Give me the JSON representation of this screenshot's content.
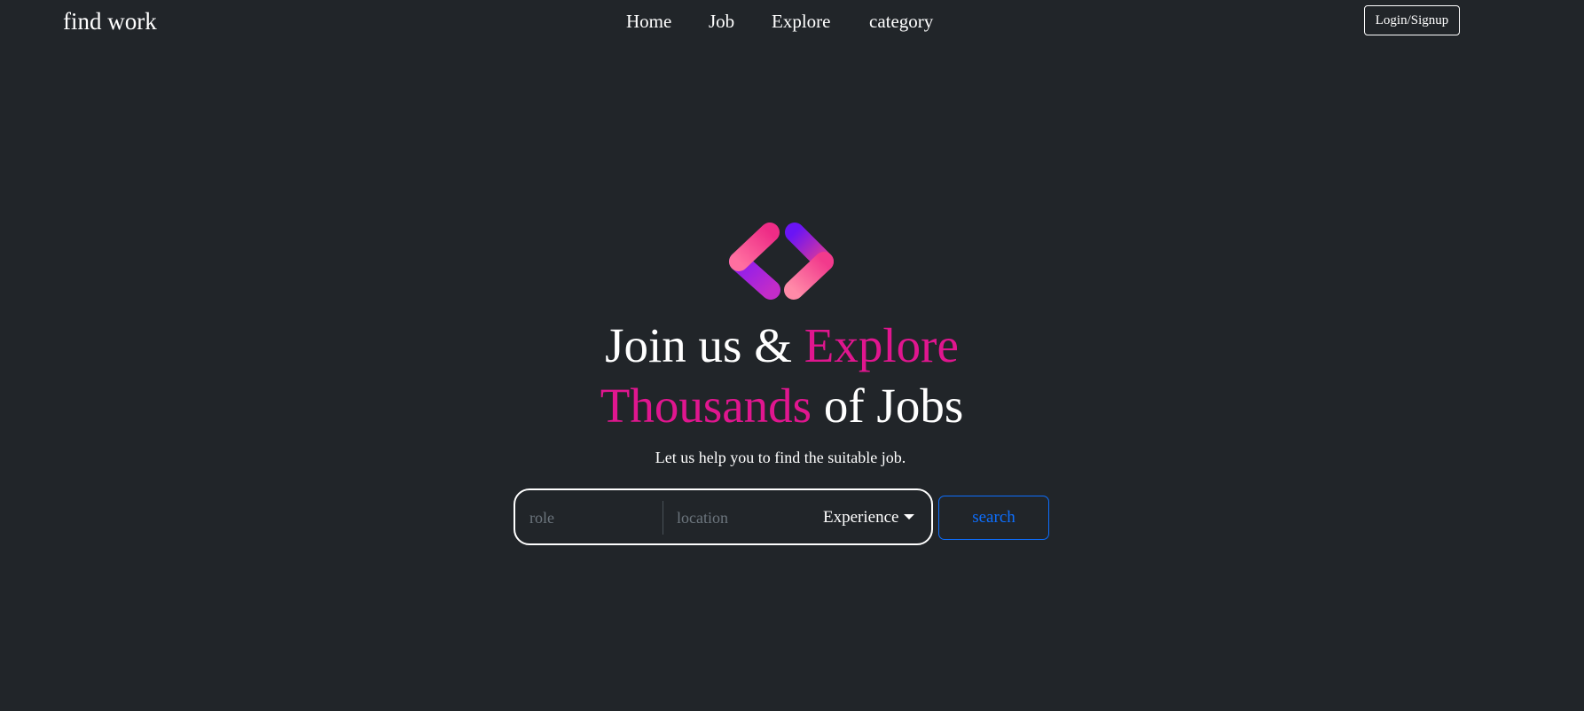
{
  "header": {
    "brand": "find work",
    "nav": [
      "Home",
      "Job",
      "Explore",
      "category"
    ],
    "login_label": "Login/Signup"
  },
  "hero": {
    "logo_icon": "code-brackets-icon",
    "headline_line1_white": "Join us & ",
    "headline_line1_accent": "Explore",
    "headline_line2_accent": "Thousands",
    "headline_line2_white": " of Jobs",
    "subtitle": "Let us help you to find the suitable job."
  },
  "search": {
    "role_placeholder": "role",
    "location_placeholder": "location",
    "experience_label": "Experience",
    "button_label": "search"
  },
  "colors": {
    "background": "#212529",
    "accent": "#e0168f",
    "primary": "#0d6efd"
  }
}
